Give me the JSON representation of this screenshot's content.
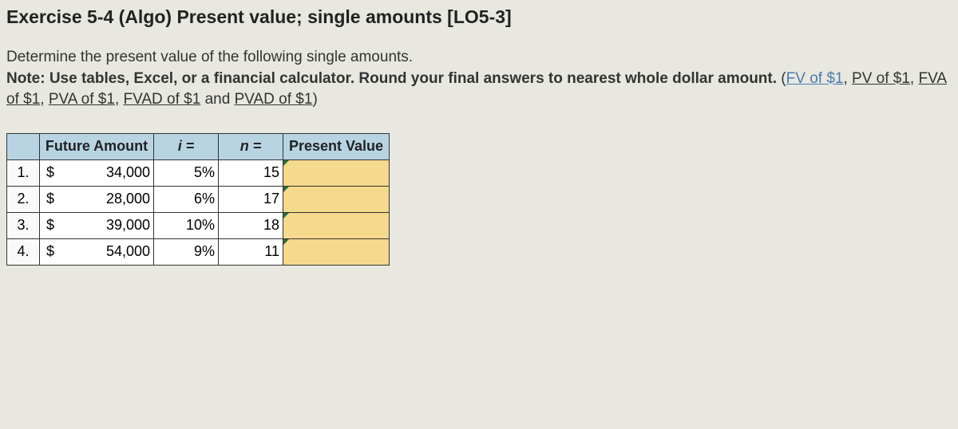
{
  "title": "Exercise 5-4 (Algo) Present value; single amounts [LO5-3]",
  "instructions": {
    "line1": "Determine the present value of the following single amounts.",
    "note_prefix": "Note: Use tables, Excel, or a financial calculator. Round your final answers to nearest whole dollar amount.",
    "paren_open": " (",
    "links": [
      "FV of $1",
      "PV of $1",
      "FVA of $1",
      "PVA of $1",
      "FVAD of $1"
    ],
    "and_text": " and ",
    "link_last": "PVAD of $1",
    "paren_close": ")"
  },
  "headers": {
    "future_amount": "Future Amount",
    "i": "i =",
    "n": "n =",
    "pv": "Present Value"
  },
  "rows": [
    {
      "num": "1.",
      "sym": "$",
      "amount": "34,000",
      "rate": "5%",
      "n": "15",
      "pv": ""
    },
    {
      "num": "2.",
      "sym": "$",
      "amount": "28,000",
      "rate": "6%",
      "n": "17",
      "pv": ""
    },
    {
      "num": "3.",
      "sym": "$",
      "amount": "39,000",
      "rate": "10%",
      "n": "18",
      "pv": ""
    },
    {
      "num": "4.",
      "sym": "$",
      "amount": "54,000",
      "rate": "9%",
      "n": "11",
      "pv": ""
    }
  ]
}
